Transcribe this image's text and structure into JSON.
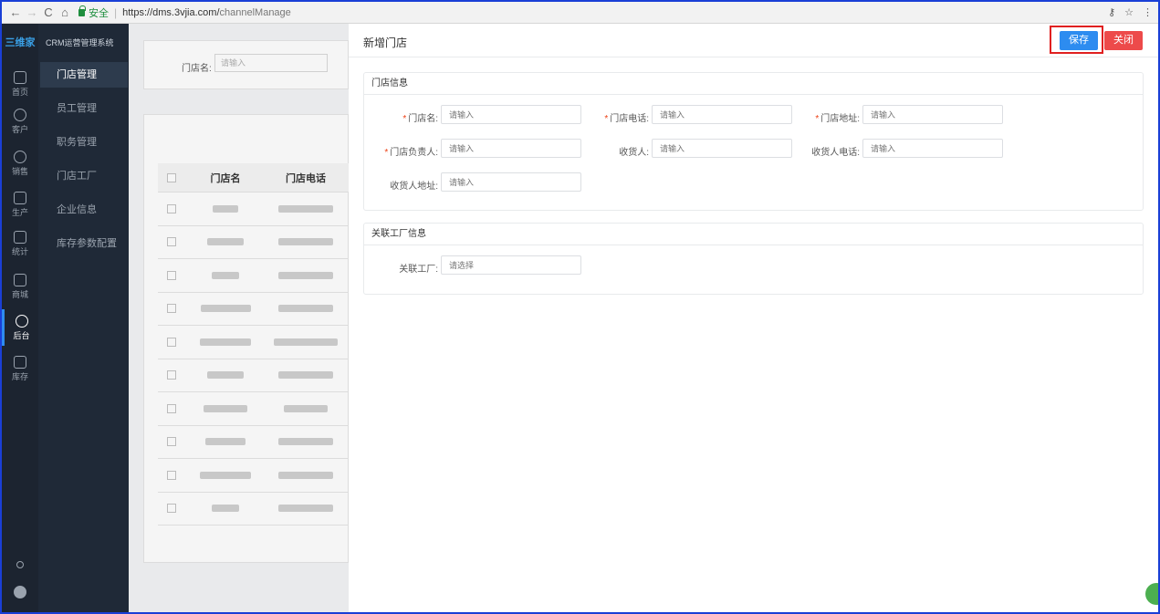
{
  "browser": {
    "secure_label": "安全",
    "url_host": "https://dms.3vjia.com/",
    "url_path": "channelManage"
  },
  "app": {
    "logo": "三维家",
    "system_title": "CRM运营管理系统"
  },
  "rail": [
    {
      "label": "首页",
      "icon": "home-icon"
    },
    {
      "label": "客户",
      "icon": "user-icon"
    },
    {
      "label": "销售",
      "icon": "sales-icon"
    },
    {
      "label": "生产",
      "icon": "tools-icon"
    },
    {
      "label": "统计",
      "icon": "document-icon"
    },
    {
      "label": "商城",
      "icon": "store-icon"
    },
    {
      "label": "后台",
      "icon": "admin-icon",
      "active": true
    },
    {
      "label": "库存",
      "icon": "warehouse-icon"
    }
  ],
  "subnav": [
    {
      "label": "门店管理",
      "active": true
    },
    {
      "label": "员工管理"
    },
    {
      "label": "职务管理"
    },
    {
      "label": "门店工厂"
    },
    {
      "label": "企业信息"
    },
    {
      "label": "库存参数配置"
    }
  ],
  "background": {
    "search_label": "门店名:",
    "search_placeholder": "请输入",
    "table_headers": [
      "门店名",
      "门店电话"
    ]
  },
  "drawer": {
    "title": "新增门店",
    "save_label": "保存",
    "close_label": "关闭",
    "store_section": {
      "title": "门店信息",
      "fields": [
        {
          "label": "门店名:",
          "required": true,
          "placeholder": "请输入"
        },
        {
          "label": "门店电话:",
          "required": true,
          "placeholder": "请输入"
        },
        {
          "label": "门店地址:",
          "required": true,
          "placeholder": "请输入"
        },
        {
          "label": "门店负责人:",
          "required": true,
          "placeholder": "请输入"
        },
        {
          "label": "收货人:",
          "required": false,
          "placeholder": "请输入"
        },
        {
          "label": "收货人电话:",
          "required": false,
          "placeholder": "请输入"
        },
        {
          "label": "收货人地址:",
          "required": false,
          "placeholder": "请输入"
        }
      ]
    },
    "factory_section": {
      "title": "关联工厂信息",
      "fields": [
        {
          "label": "关联工厂:",
          "required": false,
          "placeholder": "请选择"
        }
      ]
    }
  },
  "colors": {
    "primary": "#2d8cf0",
    "danger": "#ed4a4a",
    "sidebar": "#1f2937",
    "highlight": "#e02020"
  }
}
